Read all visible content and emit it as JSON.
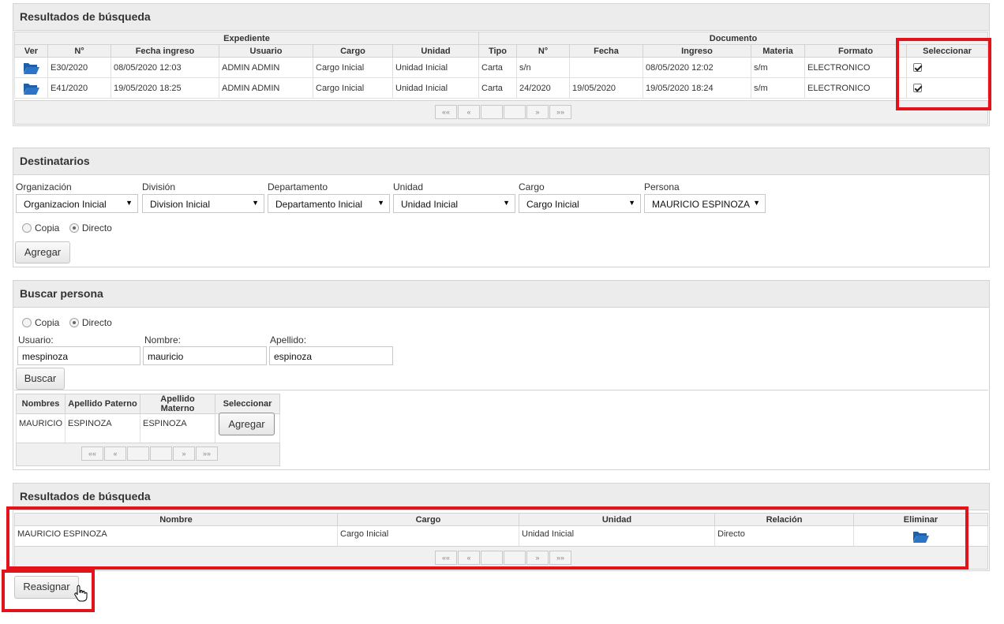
{
  "results1": {
    "title": "Resultados de búsqueda",
    "group_expediente": "Expediente",
    "group_documento": "Documento",
    "columns": [
      "Ver",
      "N°",
      "Fecha ingreso",
      "Usuario",
      "Cargo",
      "Unidad",
      "Tipo",
      "N°",
      "Fecha",
      "Ingreso",
      "Materia",
      "Formato",
      "Seleccionar"
    ],
    "rows": [
      [
        "E30/2020",
        "08/05/2020 12:03",
        "ADMIN ADMIN",
        "Cargo Inicial",
        "Unidad Inicial",
        "Carta",
        "s/n",
        "",
        "08/05/2020 12:02",
        "s/m",
        "ELECTRONICO"
      ],
      [
        "E41/2020",
        "19/05/2020 18:25",
        "ADMIN ADMIN",
        "Cargo Inicial",
        "Unidad Inicial",
        "Carta",
        "24/2020",
        "19/05/2020",
        "19/05/2020 18:24",
        "s/m",
        "ELECTRONICO"
      ]
    ],
    "pager": [
      "«« ",
      "«",
      "",
      "",
      "»",
      "»»"
    ]
  },
  "destinatarios": {
    "title": "Destinatarios",
    "fields": [
      {
        "label": "Organización",
        "value": "Organizacion Inicial"
      },
      {
        "label": "División",
        "value": "Division Inicial"
      },
      {
        "label": "Departamento",
        "value": "Departamento Inicial"
      },
      {
        "label": "Unidad",
        "value": "Unidad Inicial"
      },
      {
        "label": "Cargo",
        "value": "Cargo Inicial"
      },
      {
        "label": "Persona",
        "value": "MAURICIO ESPINOZA"
      }
    ],
    "radio_copia": "Copia",
    "radio_directo": "Directo",
    "add_button": "Agregar"
  },
  "buscar": {
    "title": "Buscar persona",
    "radio_copia": "Copia",
    "radio_directo": "Directo",
    "usuario_label": "Usuario:",
    "usuario_value": "mespinoza",
    "nombre_label": "Nombre:",
    "nombre_value": "mauricio",
    "apellido_label": "Apellido:",
    "apellido_value": "espinoza",
    "search_button": "Buscar",
    "columns": [
      "Nombres",
      "Apellido Paterno",
      "Apellido Materno",
      "Seleccionar"
    ],
    "row": [
      "MAURICIO",
      "ESPINOZA",
      "ESPINOZA"
    ],
    "row_button": "Agregar",
    "pager": [
      "««",
      "«",
      "",
      "",
      "»",
      "»»"
    ]
  },
  "results2": {
    "title": "Resultados de búsqueda",
    "columns": [
      "Nombre",
      "Cargo",
      "Unidad",
      "Relación",
      "Eliminar"
    ],
    "row": [
      "MAURICIO ESPINOZA",
      "Cargo Inicial",
      "Unidad Inicial",
      "Directo"
    ],
    "pager": [
      "««",
      "«",
      "",
      "",
      "»",
      "»»"
    ]
  },
  "reassign_button": "Reasignar",
  "colors": {
    "highlight": "#e3131b",
    "folder_icon": "#1f5fa8"
  }
}
